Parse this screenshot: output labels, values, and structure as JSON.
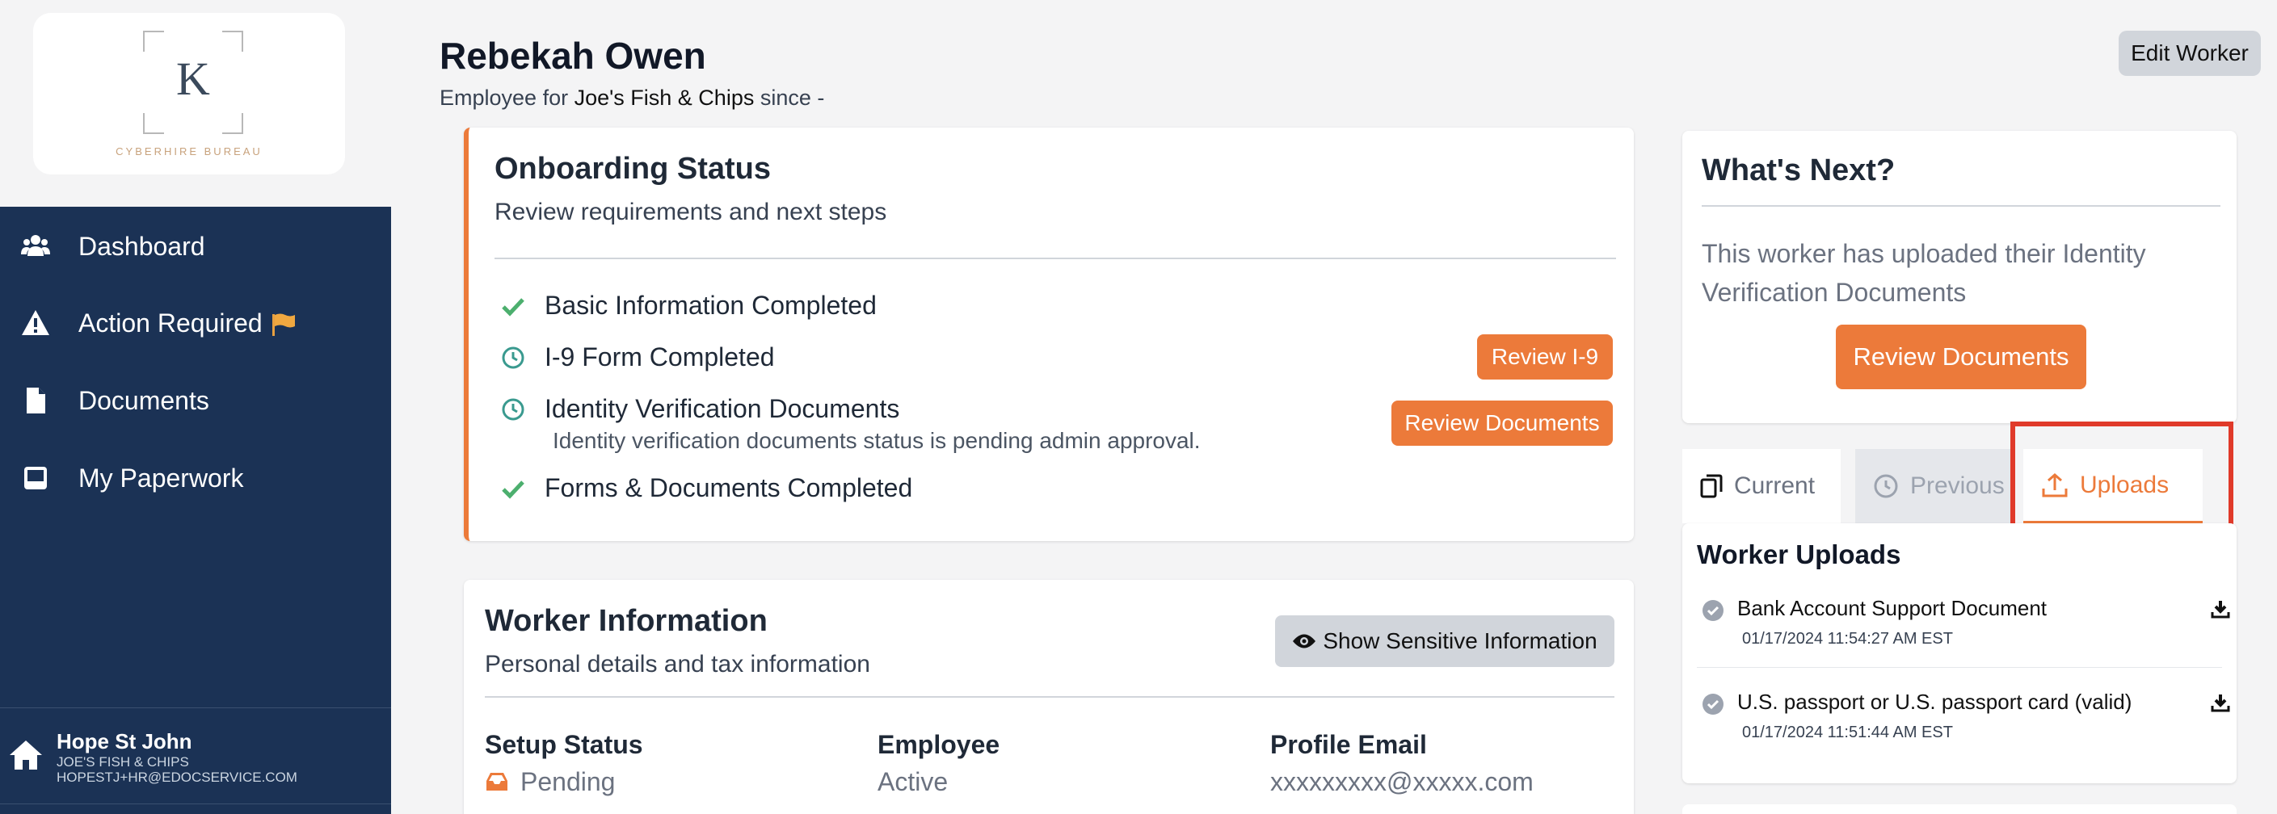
{
  "brand": {
    "letter": "K",
    "name": "CYBERHIRE BUREAU"
  },
  "sidebar": {
    "items": [
      {
        "label": "Dashboard",
        "icon": "users-icon"
      },
      {
        "label": "Action Required",
        "icon": "warning-icon",
        "badge_icon": "flag-icon"
      },
      {
        "label": "Documents",
        "icon": "file-icon"
      },
      {
        "label": "My Paperwork",
        "icon": "inbox-icon"
      }
    ],
    "user": {
      "name": "Hope St John",
      "company": "JOE'S FISH & CHIPS",
      "email": "HOPESTJ+HR@EDOCSERVICE.COM",
      "icon": "home-icon"
    }
  },
  "header": {
    "title": "Rebekah Owen",
    "subtitle_prefix": "Employee for",
    "company": "Joe's Fish & Chips",
    "subtitle_suffix": "since -",
    "edit_label": "Edit Worker"
  },
  "onboarding": {
    "title": "Onboarding Status",
    "subtitle": "Review requirements and next steps",
    "steps": [
      {
        "label": "Basic Information Completed",
        "status": "complete"
      },
      {
        "label": "I-9 Form Completed",
        "status": "pending",
        "action": "Review I-9"
      },
      {
        "label": "Identity Verification Documents",
        "status": "pending",
        "note": "Identity verification documents status is pending admin approval.",
        "action": "Review Documents"
      },
      {
        "label": "Forms & Documents Completed",
        "status": "complete"
      }
    ]
  },
  "worker_info": {
    "title": "Worker Information",
    "subtitle": "Personal details and tax information",
    "sensitive_label": "Show Sensitive Information",
    "fields": [
      {
        "label": "Setup Status",
        "value": "Pending",
        "icon": "inbox-icon"
      },
      {
        "label": "Employee",
        "value": "Active"
      },
      {
        "label": "Profile Email",
        "value": "xxxxxxxxx@xxxxx.com"
      }
    ]
  },
  "whats_next": {
    "title": "What's Next?",
    "text": "This worker has uploaded their Identity Verification Documents",
    "action": "Review Documents"
  },
  "tabs": [
    {
      "label": "Current",
      "icon": "copy-icon"
    },
    {
      "label": "Previous",
      "icon": "clock-icon"
    },
    {
      "label": "Uploads",
      "icon": "upload-icon",
      "active": true
    }
  ],
  "uploads": {
    "title": "Worker Uploads",
    "items": [
      {
        "name": "Bank Account Support Document",
        "date": "01/17/2024 11:54:27 AM EST"
      },
      {
        "name": "U.S. passport or U.S. passport card (valid)",
        "date": "01/17/2024 11:51:44 AM EST"
      }
    ]
  },
  "colors": {
    "sidebar": "#1b3255",
    "accent": "#ec7a3a",
    "success": "#4caf6e",
    "pending": "#3a9a8f",
    "highlight": "#e03a2a"
  }
}
